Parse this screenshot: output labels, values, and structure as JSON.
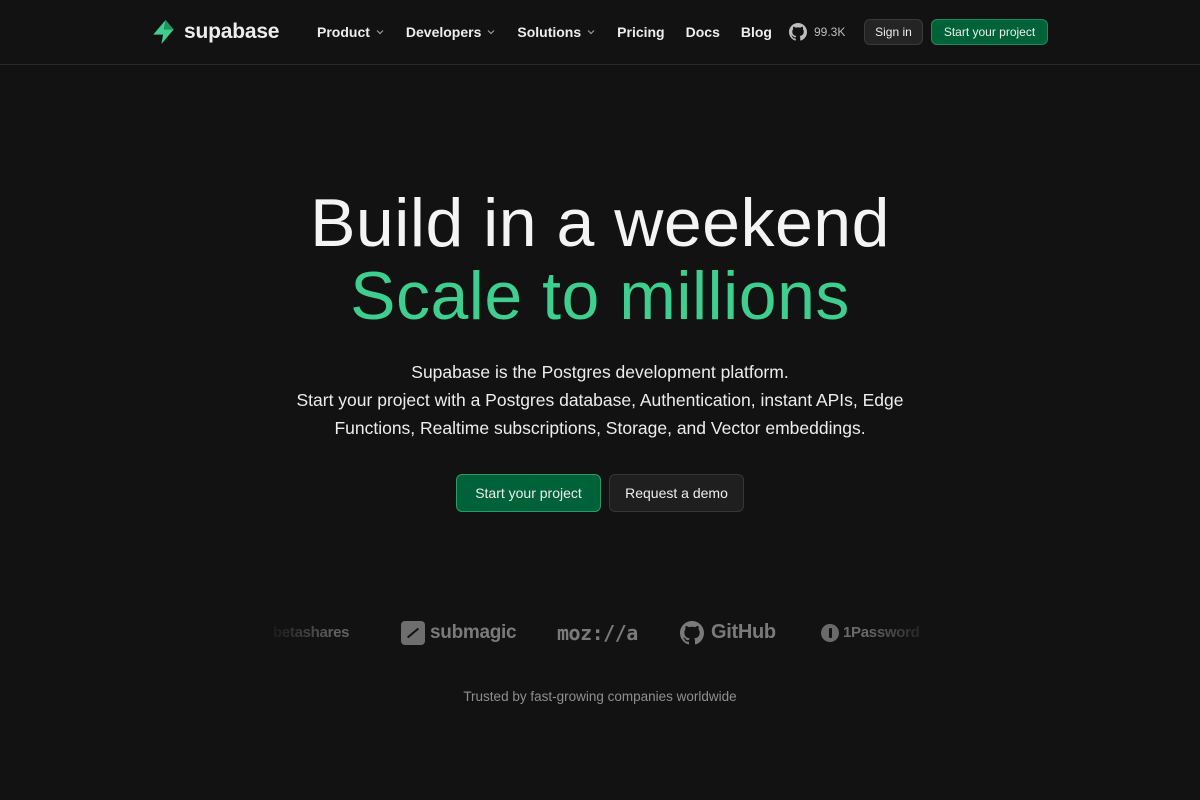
{
  "nav": {
    "brand": "supabase",
    "menu": [
      {
        "label": "Product",
        "dropdown": true
      },
      {
        "label": "Developers",
        "dropdown": true
      },
      {
        "label": "Solutions",
        "dropdown": true
      },
      {
        "label": "Pricing",
        "dropdown": false
      },
      {
        "label": "Docs",
        "dropdown": false
      },
      {
        "label": "Blog",
        "dropdown": false
      }
    ],
    "github_stars": "99.3K",
    "sign_in": "Sign in",
    "start_project": "Start your project"
  },
  "hero": {
    "title_line1": "Build in a weekend",
    "title_line2": "Scale to millions",
    "subtitle_line1": "Supabase is the Postgres development platform.",
    "subtitle_line2": "Start your project with a Postgres database, Authentication, instant APIs, Edge",
    "subtitle_line3": "Functions, Realtime subscriptions, Storage, and Vector embeddings.",
    "primary_cta": "Start your project",
    "secondary_cta": "Request a demo"
  },
  "logos": {
    "items": [
      "betashares",
      "submagic",
      "moz://a",
      "GitHub",
      "1Password"
    ],
    "caption": "Trusted by fast-growing companies worldwide"
  },
  "colors": {
    "background": "#121212",
    "brand_green": "#3ecf8e",
    "button_green": "#006239"
  },
  "icons": {
    "brand": "supabase-bolt-icon",
    "dropdown": "chevron-down-icon",
    "github": "github-icon"
  }
}
